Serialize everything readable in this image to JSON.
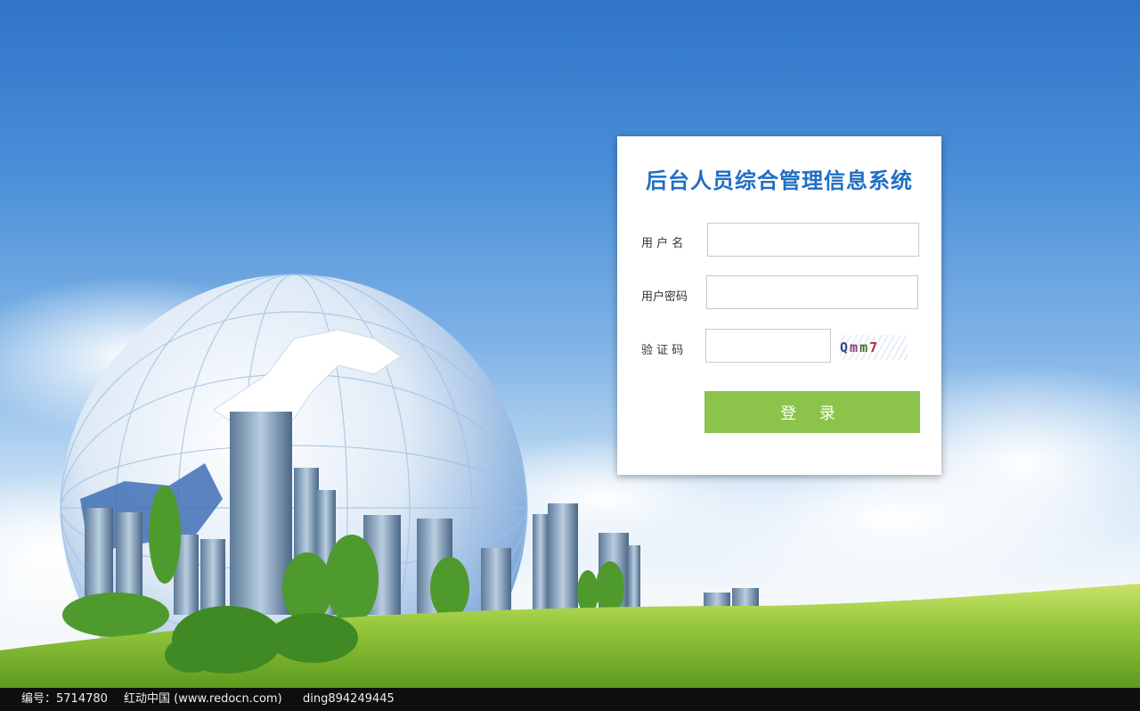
{
  "login": {
    "title": "后台人员综合管理信息系统",
    "username_label": "用 户 名",
    "password_label": "用户密码",
    "captcha_label": "验 证 码",
    "username_value": "",
    "password_value": "",
    "captcha_value": "",
    "captcha_chars": [
      "Q",
      "m",
      "m",
      "7"
    ],
    "login_button": "登 录"
  },
  "footer": {
    "id_text": "编号：5714780",
    "site_text": "红动中国 (www.redocn.com)",
    "user_text": "ding894249445"
  },
  "colors": {
    "title": "#1f6fc4",
    "button": "#8cc34a",
    "footer_bg": "#0e0e0e"
  }
}
